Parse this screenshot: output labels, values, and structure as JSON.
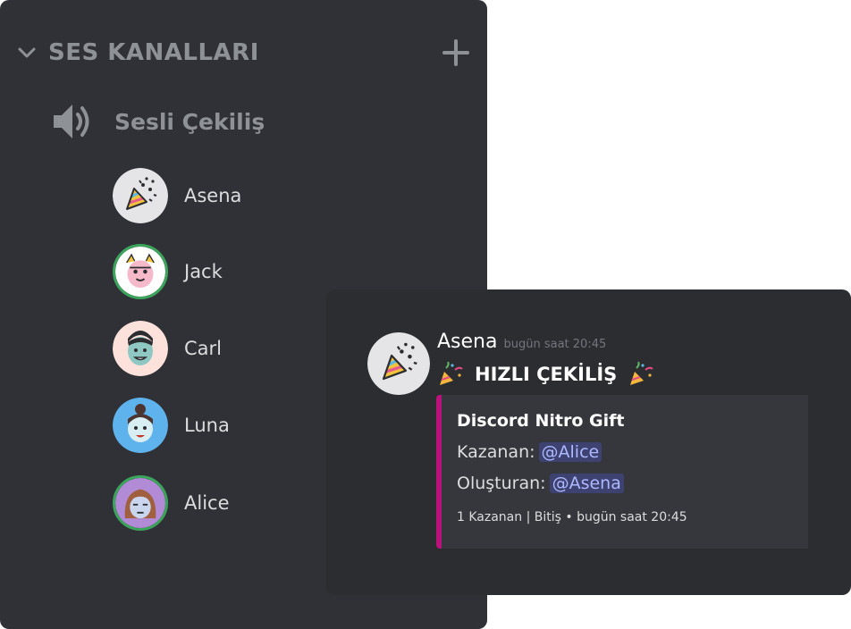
{
  "voice_section": {
    "category_label": "SES KANALLARI",
    "chevron_icon": "chevron-down-icon",
    "add_icon": "plus-icon",
    "channel": {
      "icon": "speaker-icon",
      "name": "Sesli Çekiliş"
    },
    "members": [
      {
        "name": "Asena",
        "avatar": "party-popper",
        "speaking": false
      },
      {
        "name": "Jack",
        "avatar": "pink-character",
        "speaking": true
      },
      {
        "name": "Carl",
        "avatar": "face-peach",
        "speaking": false
      },
      {
        "name": "Luna",
        "avatar": "face-blue",
        "speaking": false
      },
      {
        "name": "Alice",
        "avatar": "face-purple",
        "speaking": true
      }
    ]
  },
  "message": {
    "author": "Asena",
    "timestamp": "bugün saat 20:45",
    "content_title": "HIZLI ÇEKİLİŞ",
    "emoji_icon": "party-popper-icon",
    "embed": {
      "accent_color": "#b9127a",
      "title": "Discord Nitro Gift",
      "winner_label": "Kazanan:",
      "winner_mention": "@Alice",
      "creator_label": "Oluşturan:",
      "creator_mention": "@Asena",
      "footer": "1 Kazanan | Bitiş • bugün saat 20:45"
    }
  },
  "colors": {
    "panel_bg": "#303136",
    "card_bg": "#2c2d31",
    "speaking_ring": "#3ba55c",
    "mention_bg": "#3d4270",
    "mention_text": "#aeb8ff"
  }
}
